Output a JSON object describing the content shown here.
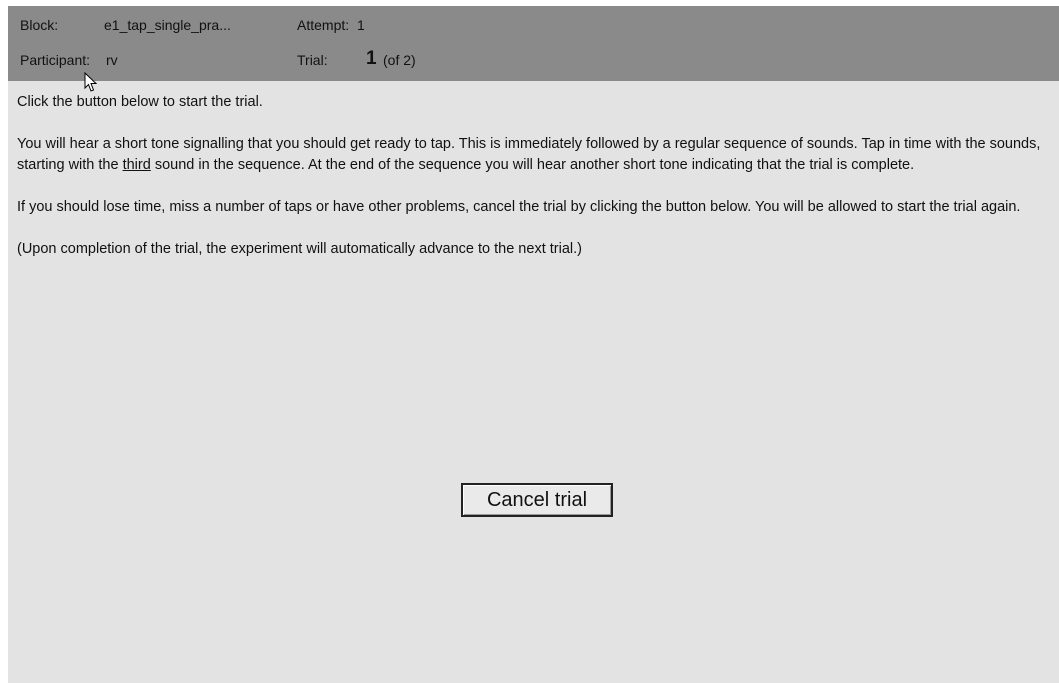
{
  "header": {
    "block_label": "Block:",
    "block_value": "e1_tap_single_pra...",
    "attempt_label": "Attempt:",
    "attempt_value": "1",
    "participant_label": "Participant:",
    "participant_value": "rv",
    "trial_label": "Trial:",
    "trial_value": "1",
    "trial_total": "(of 2)"
  },
  "instructions": {
    "p1": "Click the button below to start the trial.",
    "p2_before": "You will hear a short tone signalling that you should get ready to tap. This is immediately followed by a regular sequence of sounds. Tap in time with the sounds, starting with the ",
    "p2_underlined": "third",
    "p2_after": " sound in the sequence. At the end of the sequence you will hear another short tone indicating that the trial is complete.",
    "p3": "If you should lose time, miss a number of taps or have other problems, cancel the trial by clicking the button below. You will be allowed to start the trial again.",
    "p4": "(Upon completion of the trial, the experiment will automatically advance to the next trial.)"
  },
  "cancel_button_label": "Cancel trial",
  "icons": {
    "cursor": "mouse-pointer-icon"
  }
}
